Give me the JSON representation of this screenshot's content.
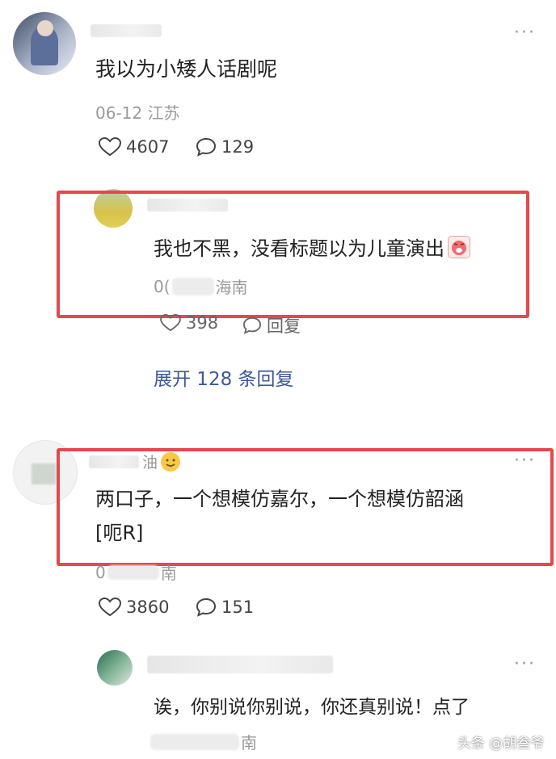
{
  "comment1": {
    "text": "我以为小矮人话剧呢",
    "date": "06-12",
    "location": "江苏",
    "likes": "4607",
    "replies": "129",
    "more_icon": "more-icon"
  },
  "reply1": {
    "text": "我也不黑，没看标题以为儿童演出",
    "meta_prefix": "0(",
    "location": "海南",
    "likes": "398",
    "reply_label": "回复",
    "emoji": "crying-face"
  },
  "expand": {
    "label": "展开 128 条回复"
  },
  "comment2": {
    "name_fragment": "油",
    "line1": "两口子，一个想模仿嘉尔，一个想模仿韶涵",
    "line2": "[呃R]",
    "meta_prefix": "0",
    "location": "南",
    "likes": "3860",
    "replies": "151"
  },
  "reply2": {
    "text": "诶，你别说你别说，你还真别说！点了",
    "meta_fragment": "南"
  },
  "watermark": "头条 @胡叁爷",
  "colors": {
    "highlight_border": "#e5484d",
    "link": "#3b5998",
    "meta_gray": "#9a9a9a"
  }
}
